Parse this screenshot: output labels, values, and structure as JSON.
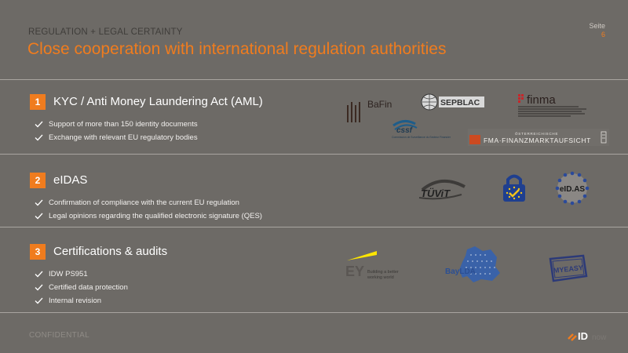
{
  "header": {
    "subtitle": "REGULATION + LEGAL CERTAINTY",
    "title": "Close cooperation with international regulation authorities",
    "page_label": "Seite",
    "page_number": "6"
  },
  "sections": [
    {
      "number": "1",
      "title": "KYC / Anti Money Laundering Act (AML)",
      "bullets": [
        "Support of more than 150 identity documents",
        "Exchange with relevant EU regulatory bodies"
      ],
      "logos": {
        "bafin": "BaFin",
        "sepblac": "SEPBLAC",
        "finma": "finma",
        "cssf_name": "cssf",
        "cssf_caption": "Commission de Surveillance du Secteur Financier",
        "fma_small": "ÖSTERREICHISCHE",
        "fma_name": "FMA·FINANZMARKTAUFSICHT"
      }
    },
    {
      "number": "2",
      "title": "eIDAS",
      "bullets": [
        "Confirmation of compliance with the current EU regulation",
        "Legal opinions regarding the qualified electronic signature (QES)"
      ],
      "logos": {
        "tuvit": "TÜViT",
        "eidas": "eID.AS"
      }
    },
    {
      "number": "3",
      "title": "Certifications & audits",
      "bullets": [
        "IDW PS951",
        "Certified data protection",
        "Internal revision"
      ],
      "logos": {
        "ey": "EY",
        "ey_tagline_1": "Building a better",
        "ey_tagline_2": "working world",
        "baylda": "BayLDA",
        "stamp": "MYEASY"
      }
    }
  ],
  "footer": {
    "confidential": "CONFIDENTIAL",
    "brand_mark": "ID",
    "brand_suffix": "now"
  },
  "colors": {
    "background": "#6d6a66",
    "accent": "#f07c1e",
    "text": "#ffffff"
  }
}
